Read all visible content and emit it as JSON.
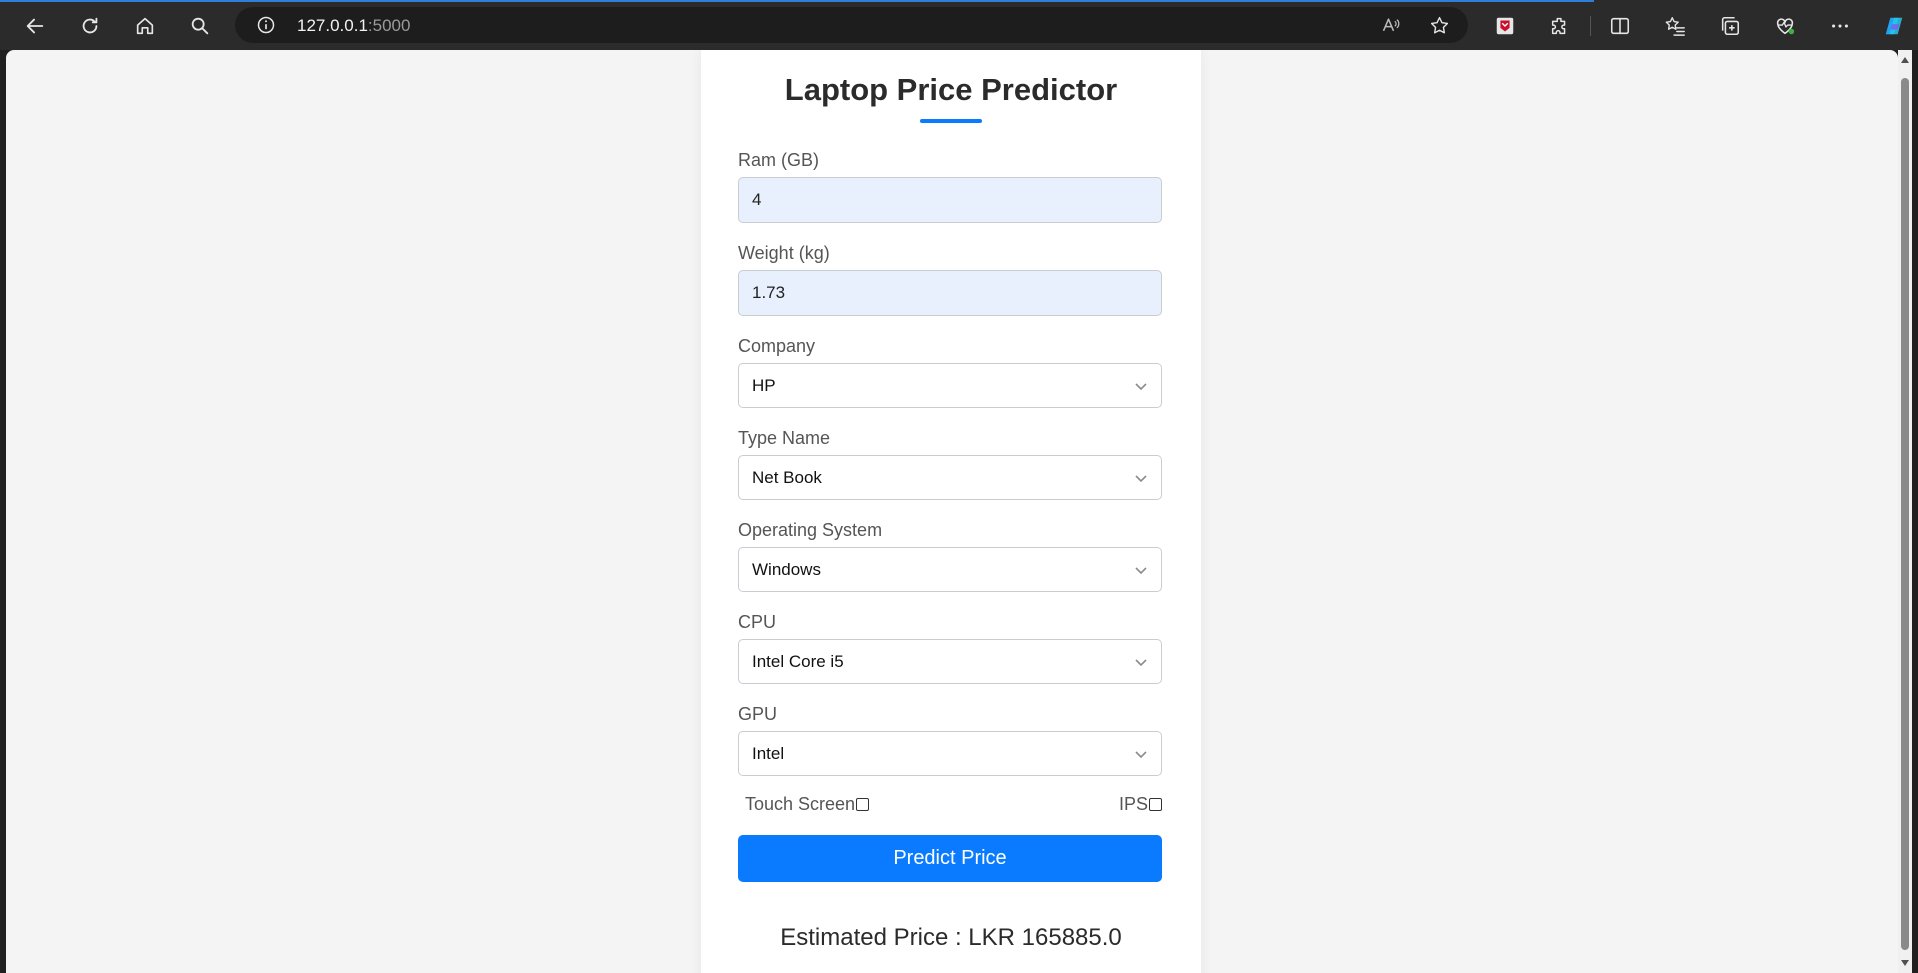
{
  "browser": {
    "url_host": "127.0.0.1",
    "url_port": ":5000",
    "icons": {
      "back": "arrow-left-icon",
      "refresh": "refresh-icon",
      "home": "home-icon",
      "search": "search-icon",
      "info": "info-icon",
      "read_aloud": "read-aloud-icon",
      "favorite": "star-icon",
      "extensions": "puzzle-icon",
      "split": "split-screen-icon",
      "favorites": "favorites-list-icon",
      "collections": "collections-icon",
      "health": "heart-pulse-icon",
      "more": "ellipsis-icon",
      "copilot": "copilot-icon"
    }
  },
  "page": {
    "title": "Laptop Price Predictor",
    "fields": {
      "ram": {
        "label": "Ram (GB)",
        "value": "4"
      },
      "weight": {
        "label": "Weight (kg)",
        "value": "1.73"
      },
      "company": {
        "label": "Company",
        "value": "HP"
      },
      "type_name": {
        "label": "Type Name",
        "value": "Net Book"
      },
      "os": {
        "label": "Operating System",
        "value": "Windows"
      },
      "cpu": {
        "label": "CPU",
        "value": "Intel Core i5"
      },
      "gpu": {
        "label": "GPU",
        "value": "Intel"
      }
    },
    "touch_screen_label": "Touch Screen",
    "ips_label": "IPS",
    "predict_button": "Predict Price",
    "result": "Estimated Price : LKR 165885.0"
  },
  "colors": {
    "accent": "#0a7bff",
    "input_bg": "#e8f0fe",
    "page_bg": "#f4f4f4",
    "chrome_bg": "#2b2b2b"
  }
}
